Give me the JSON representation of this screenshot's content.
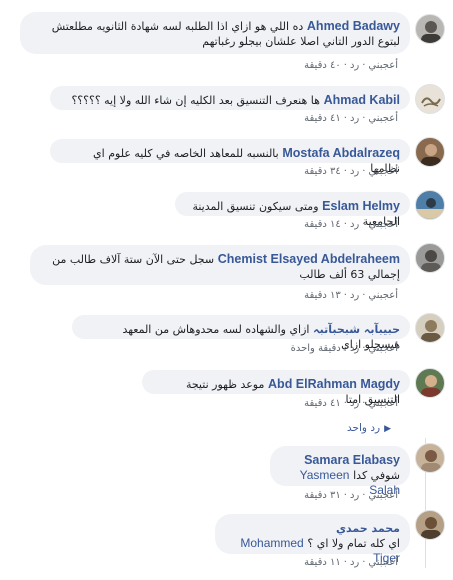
{
  "comments": [
    {
      "author": "Ahmed Badawy",
      "text": "ده اللي هو ازاي اذا الطلبه لسه شهادة الثانويه مطلعتش لبتوع الدور التاني اصلا علشان بيجلو رغباتهم",
      "like": "أعجبني",
      "reply": "رد",
      "time": "٤٠ دقيقة"
    },
    {
      "author": "Ahmad Kabil",
      "text": "ها هنعرف التنسيق بعد الكليه إن شاء الله ولا إيه ؟؟؟؟؟",
      "like": "أعجبني",
      "reply": "رد",
      "time": "٤١ دقيقة"
    },
    {
      "author": "Mostafa Abdalrazeq",
      "text": "بالنسبه للمعاهد الخاصه في كليه علوم اي نظامها",
      "like": "أعجبني",
      "reply": "رد",
      "time": "٣٤ دقيقة"
    },
    {
      "author": "Eslam Helmy",
      "text": "ومتى سيكون تنسيق المدينة الجامعية",
      "like": "أعجبني",
      "reply": "رد",
      "time": "١٤ دقيقة"
    },
    {
      "author": "Chemist Elsayed Abdelraheem",
      "text": "سجل حتى الآن ستة آلاف طالب من إجمالي 63 ألف طالب",
      "like": "أعجبني",
      "reply": "رد",
      "time": "١٣ دقيقة"
    },
    {
      "author": "حبيبآبہ شبحبآتبہ",
      "text": "ازاي والشهاده لسه محدوهاش من المعهد هيسجلو ازاي",
      "like": "أعجبني",
      "reply": "رد",
      "time": "دقيقة واحدة"
    },
    {
      "author": "Abd ElRahman Magdy",
      "text": "موعد ظهور نتيجة التنسيق امتا",
      "like": "أعجبني",
      "reply": "رد",
      "time": "٤١ دقيقة",
      "reply_toggle": "رد واحد"
    }
  ],
  "replies": [
    {
      "author": "Samara Elabasy",
      "tag": "Yasmeen Salah",
      "text": "شوفي كدا",
      "like": "أعجبني",
      "reply": "رد",
      "time": "٣١ دقيقة"
    },
    {
      "author": "محمد حمدي",
      "tag": "Mohammed Tiger",
      "text": "اي كله تمام ولا اي ؟",
      "like": "أعجبني",
      "reply": "رد",
      "time": "١١ دقيقة"
    }
  ]
}
